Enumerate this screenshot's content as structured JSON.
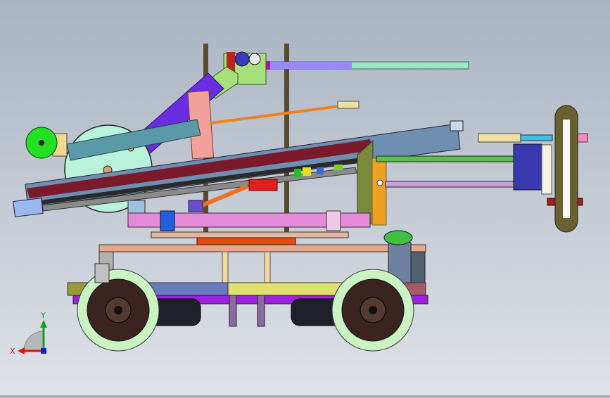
{
  "view": {
    "background_top": "#a9b3c2",
    "background_bottom": "#dfe2e7"
  },
  "triad": {
    "x_label": "X",
    "y_label": "Y",
    "x_color": "#e01010",
    "y_color": "#10a020",
    "z_color": "#1020d0"
  },
  "model": {
    "name": "robot-chassis-side-view",
    "colors": {
      "mast": "#5b4a2e",
      "arm": "#6a2ee0",
      "disc": "#b8f2da",
      "rail": "#7a1a2a",
      "rail_frame": "#6f8fb0",
      "table": "#e58ad8",
      "deck": "#e7a58a",
      "wheel": "#3a2320",
      "roller": "#c9f3c0",
      "motor": "#20202a",
      "bumper_segments": [
        "#9a9a3a",
        "#6a7ac0",
        "#e0e06a",
        "#a85a6a"
      ]
    }
  }
}
